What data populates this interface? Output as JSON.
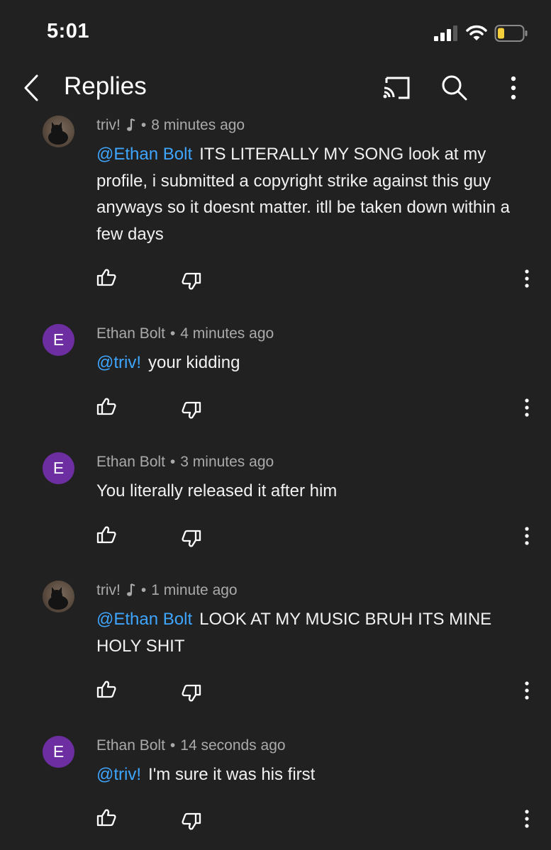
{
  "status_bar": {
    "time": "5:01"
  },
  "header": {
    "title": "Replies"
  },
  "comments": [
    {
      "author": "triv!",
      "time": "8 minutes ago",
      "mention": "@Ethan Bolt",
      "text": "ITS LITERALLY MY SONG look at my profile, i submitted a copyright strike against this guy anyways so it doesnt matter. itll be taken down within a few days"
    },
    {
      "author": "Ethan Bolt",
      "avatar_letter": "E",
      "time": "4 minutes ago",
      "mention": "@triv!",
      "text": "your kidding"
    },
    {
      "author": "Ethan Bolt",
      "avatar_letter": "E",
      "time": "3 minutes ago",
      "text": "You literally released it after him"
    },
    {
      "author": "triv!",
      "time": "1 minute ago",
      "mention": "@Ethan Bolt",
      "text": "LOOK AT MY MUSIC BRUH ITS MINE HOLY SHIT"
    },
    {
      "author": "Ethan Bolt",
      "avatar_letter": "E",
      "time": "14 seconds ago",
      "mention": "@triv!",
      "text": "I'm sure it was his first"
    }
  ],
  "colors": {
    "background": "#212121",
    "mention": "#3ea6ff",
    "avatar_e": "#6c2ea0",
    "meta_text": "#aaaaaa",
    "battery_fill": "#f5cf3b"
  }
}
